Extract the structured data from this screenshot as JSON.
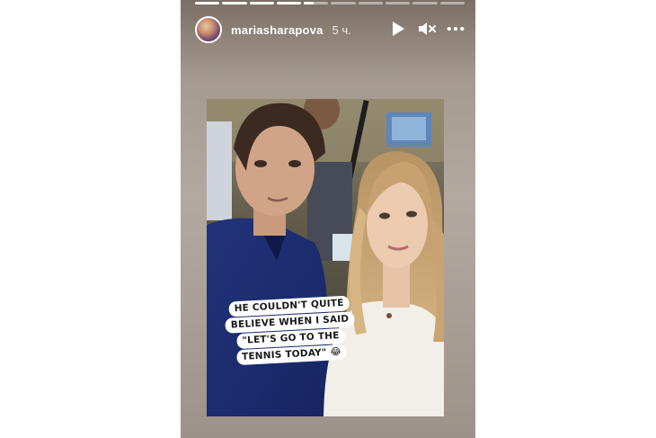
{
  "story": {
    "progress_segments": [
      1,
      1,
      1,
      1,
      0.4,
      0,
      0,
      0,
      0,
      0
    ],
    "header": {
      "username": "mariasharapova",
      "time": "5 ч."
    },
    "controls": {
      "play_icon": "play-icon",
      "mute_icon": "speaker-muted-icon",
      "more_icon": "more-dots-icon"
    },
    "caption": {
      "lines": [
        "HE COULDN'T QUITE",
        "BELIEVE WHEN I SAID",
        "\"LET'S GO TO THE",
        "TENNIS TODAY\" 😂"
      ]
    }
  }
}
